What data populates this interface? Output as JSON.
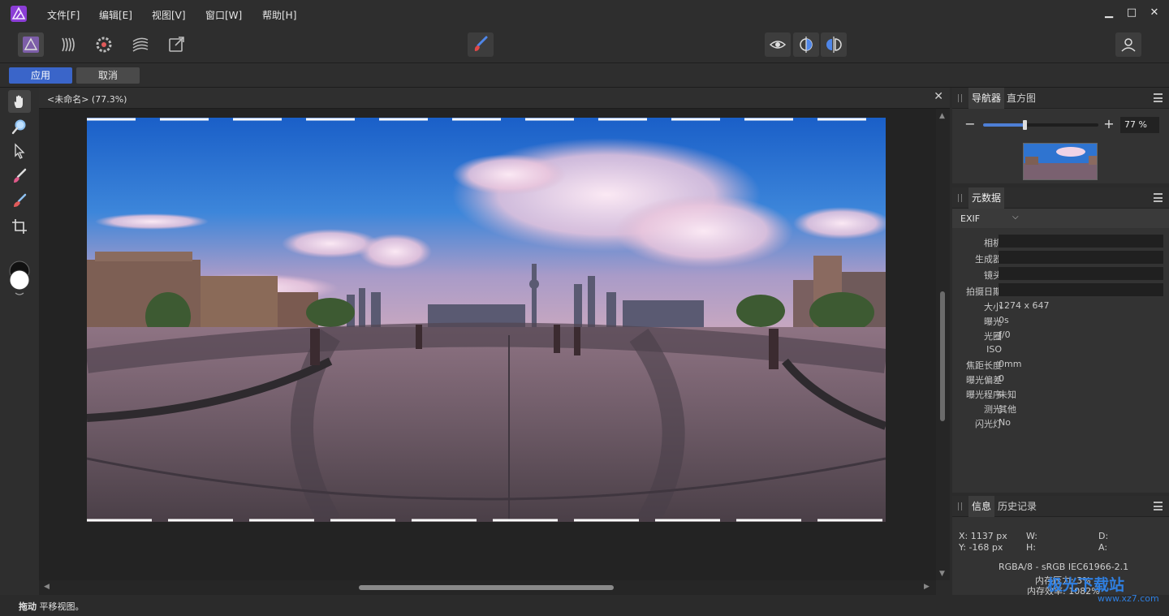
{
  "menu": {
    "items": [
      "文件[F]",
      "编辑[E]",
      "视图[V]",
      "窗口[W]",
      "帮助[H]"
    ],
    "window_buttons": [
      "minimize-icon",
      "maximize-icon",
      "close-icon"
    ]
  },
  "toolbar": {
    "personas": [
      "photo-persona-icon",
      "liquify-persona-icon",
      "develop-persona-icon",
      "tone-mapping-persona-icon",
      "export-persona-icon"
    ],
    "center_tool": "brush-tool-icon",
    "view_tools": [
      "preview-eye-icon",
      "split-view-icon",
      "mirror-view-icon"
    ],
    "account": "user-icon"
  },
  "context": {
    "apply": "应用",
    "cancel": "取消"
  },
  "tools": [
    "hand-icon",
    "zoom-icon",
    "pointer-icon",
    "brush-icon",
    "erase-brush-icon",
    "crop-icon"
  ],
  "document": {
    "title": "<未命名> (77.3%)",
    "close": "✕"
  },
  "status": {
    "bold": "拖动",
    "text": "平移视图。"
  },
  "navigator": {
    "tabs": [
      "导航器",
      "直方图"
    ],
    "zoom_value": "77 %",
    "zoom_fraction": 0.36
  },
  "metadata": {
    "tab": "元数据",
    "preset": "EXIF",
    "input_fields": [
      "相机",
      "生成器",
      "镜头",
      "拍摄日期"
    ],
    "rows": [
      {
        "key": "大小",
        "value": "1274 x 647"
      },
      {
        "key": "曝光",
        "value": "0s"
      },
      {
        "key": "光圈",
        "value": "ƒ/0"
      },
      {
        "key": "ISO",
        "value": ""
      },
      {
        "key": "焦距长度",
        "value": "0mm"
      },
      {
        "key": "曝光偏差",
        "value": "0"
      },
      {
        "key": "曝光程序",
        "value": "未知"
      },
      {
        "key": "测光",
        "value": "其他"
      },
      {
        "key": "闪光灯",
        "value": "No"
      }
    ]
  },
  "info": {
    "tabs": [
      "信息",
      "历史记录"
    ],
    "x": "X: 1137 px",
    "y": "Y: -168 px",
    "w": "W:",
    "h": "H:",
    "d": "D:",
    "a": "A:",
    "color_profile": "RGBA/8 - sRGB IEC61966-2.1",
    "memory_pressure": "内存压力: 3%",
    "memory_efficiency": "内存效率: 1082%"
  },
  "watermark": {
    "text": "极光下载站",
    "url": "www.xz7.com"
  }
}
